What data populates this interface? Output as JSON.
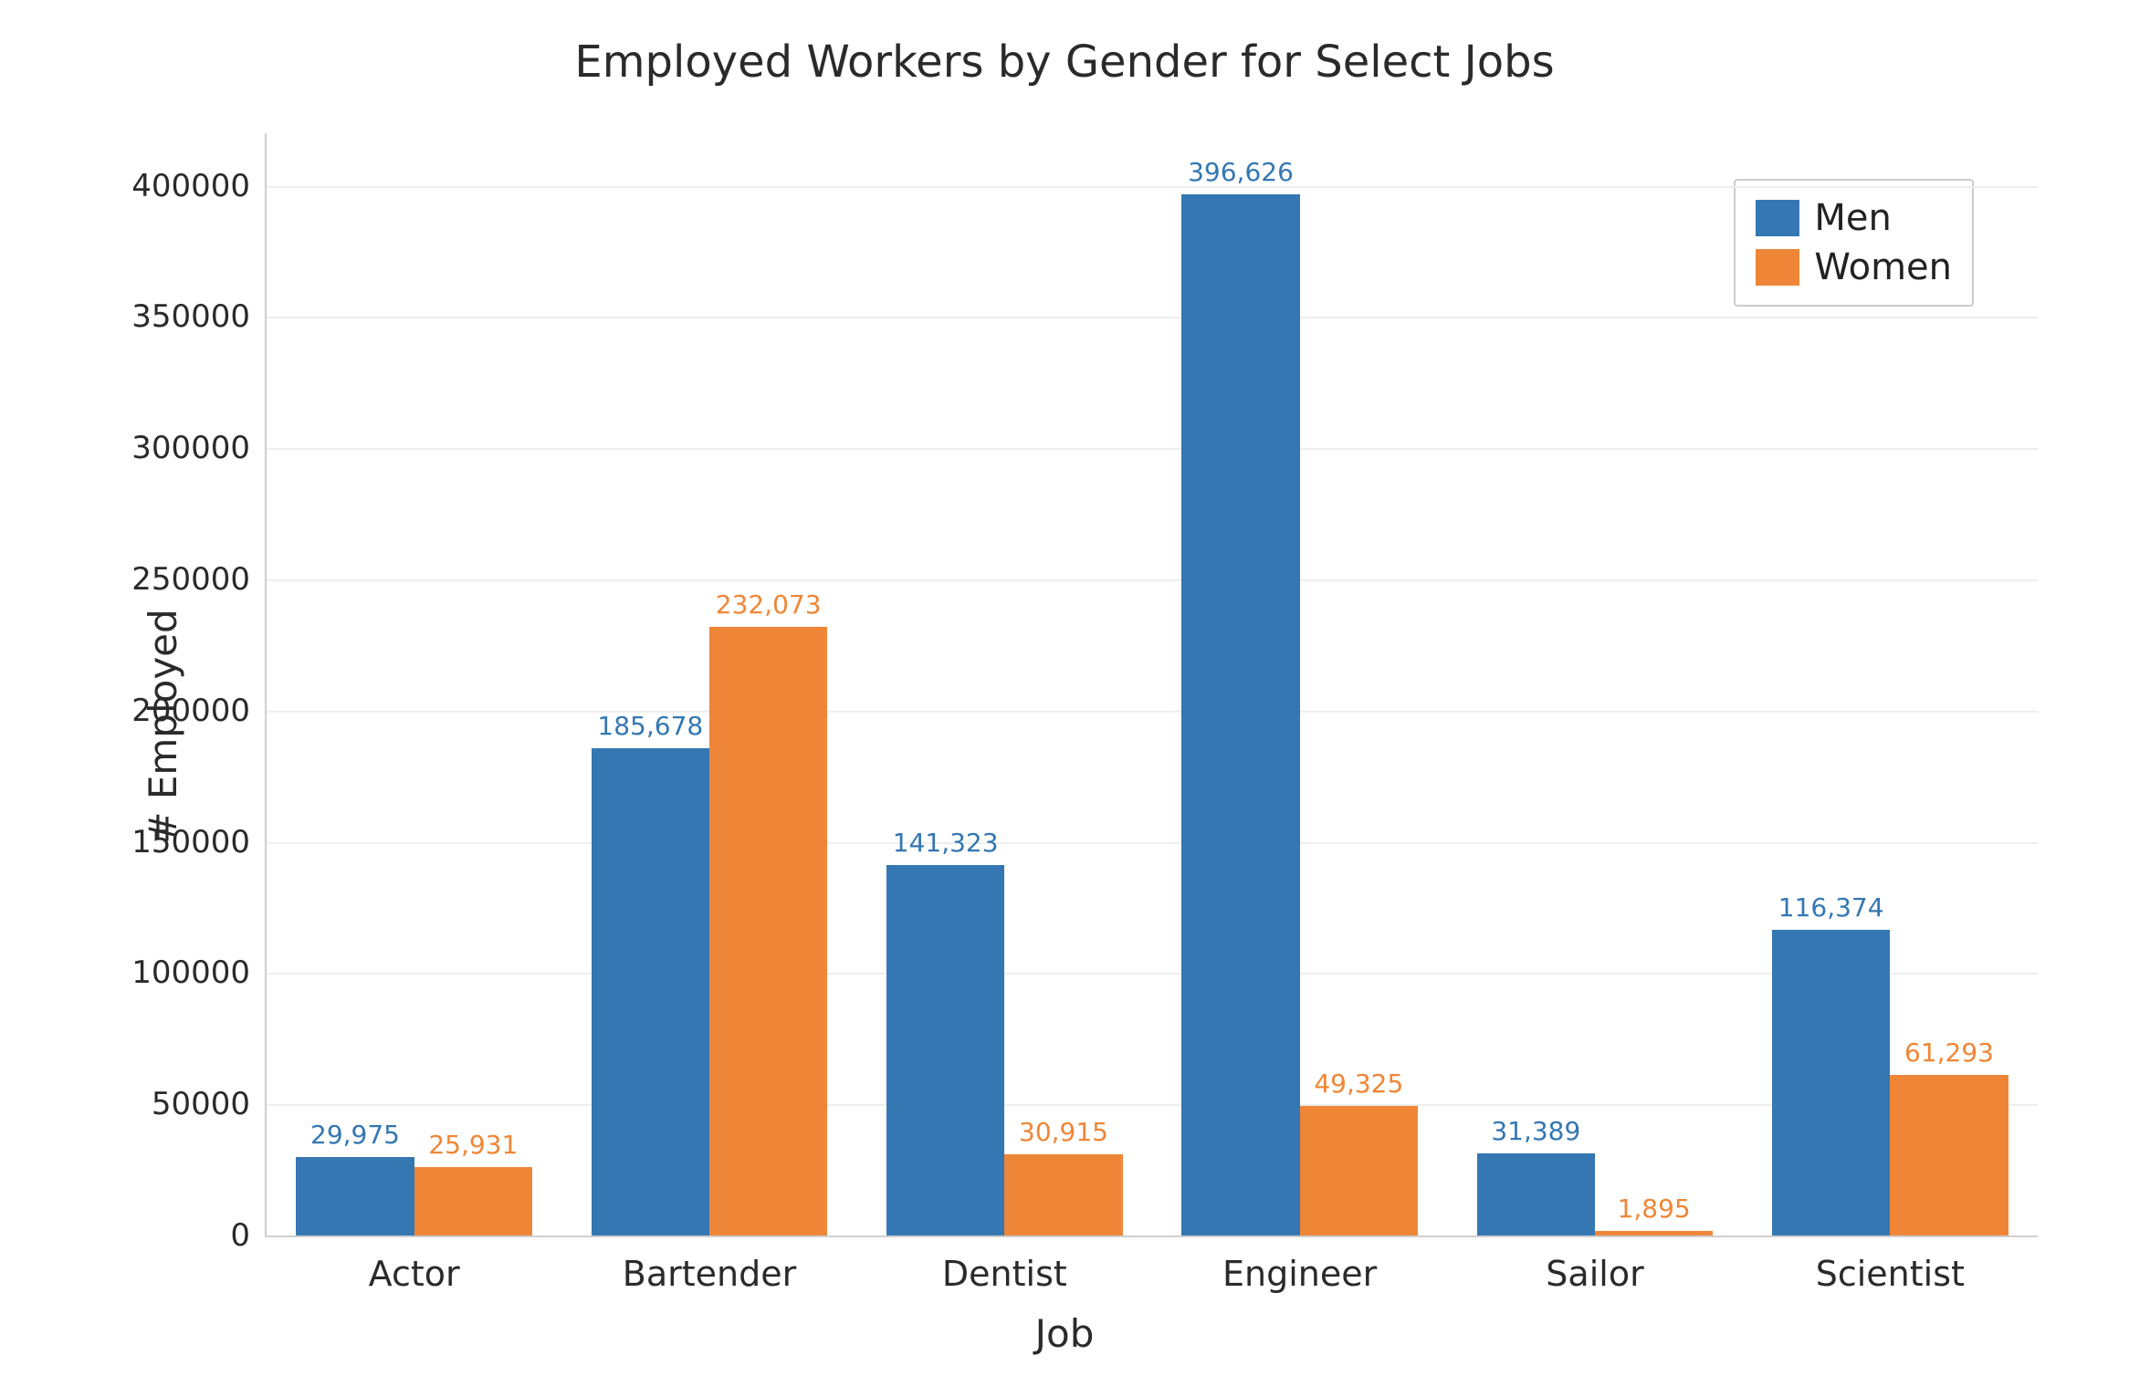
{
  "chart_data": {
    "type": "bar",
    "title": "Employed Workers by Gender for Select Jobs",
    "xlabel": "Job",
    "ylabel": "# Employed",
    "ylim": [
      0,
      420000
    ],
    "yticks": [
      0,
      50000,
      100000,
      150000,
      200000,
      250000,
      300000,
      350000,
      400000
    ],
    "ytick_labels": [
      "0",
      "50000",
      "100000",
      "150000",
      "200000",
      "250000",
      "300000",
      "350000",
      "400000"
    ],
    "categories": [
      "Actor",
      "Bartender",
      "Dentist",
      "Engineer",
      "Sailor",
      "Scientist"
    ],
    "series": [
      {
        "name": "Men",
        "color": "#3477b2",
        "values": [
          29975,
          185678,
          141323,
          396626,
          31389,
          116374
        ],
        "value_labels": [
          "29,975",
          "185,678",
          "141,323",
          "396,626",
          "31,389",
          "116,374"
        ]
      },
      {
        "name": "Women",
        "color": "#ef8637",
        "values": [
          25931,
          232073,
          30915,
          49325,
          1895,
          61293
        ],
        "value_labels": [
          "25,931",
          "232,073",
          "30,915",
          "49,325",
          "1,895",
          "61,293"
        ]
      }
    ],
    "legend_position": "upper-right",
    "grid": true
  }
}
